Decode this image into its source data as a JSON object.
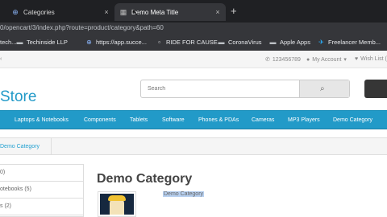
{
  "browser": {
    "tabs": [
      {
        "title": "Categories",
        "active": false
      },
      {
        "title": "Demo Meta Title",
        "active": true
      }
    ],
    "close_glyph": "×",
    "new_tab_glyph": "+",
    "url": "0/opencart/3/index.php?route=product/category&path=60",
    "bookmarks": [
      {
        "label": "tech...",
        "icon": "page-icon"
      },
      {
        "label": "Techinside LLP",
        "icon": "folder-icon"
      },
      {
        "label": "https://app.succe...",
        "icon": "globe-icon"
      },
      {
        "label": "RIDE FOR CAUSE",
        "icon": "page-icon"
      },
      {
        "label": "CoronaVirus",
        "icon": "folder-icon"
      },
      {
        "label": "Apple Apps",
        "icon": "folder-icon"
      },
      {
        "label": "Freelancer Memb...",
        "icon": "freelancer-icon"
      }
    ]
  },
  "store": {
    "topbar": {
      "left": "‹",
      "phone": "123456789",
      "account": "My Account",
      "wishlist": "Wish List ("
    },
    "logo": "Store",
    "search_placeholder": "Search",
    "menu": [
      "Laptops & Notebooks",
      "Components",
      "Tablets",
      "Software",
      "Phones & PDAs",
      "Cameras",
      "MP3 Players",
      "Demo Category"
    ],
    "breadcrumb": "Demo Category",
    "sidebar": [
      "0)",
      "otebooks (5)",
      "s (2)"
    ],
    "heading": "Demo Category",
    "description": "Demo Category"
  },
  "colors": {
    "accent": "#229ac8",
    "chrome_dark": "#1f2023",
    "chrome_mid": "#35363a"
  }
}
